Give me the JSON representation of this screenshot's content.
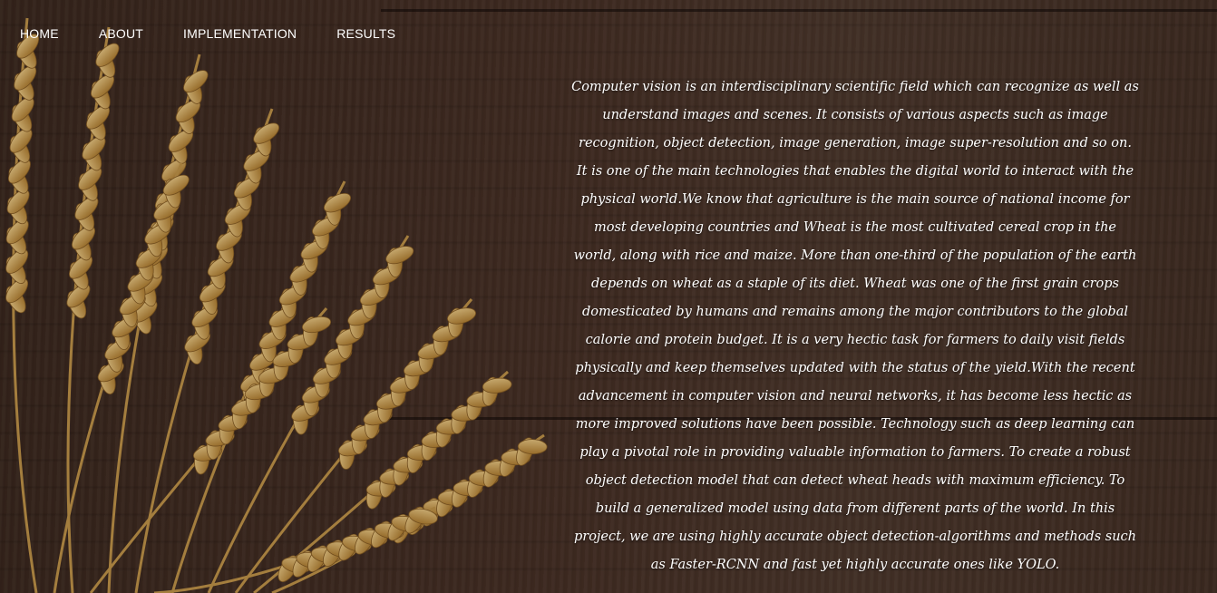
{
  "nav": {
    "items": [
      {
        "label": "HOME"
      },
      {
        "label": "ABOUT"
      },
      {
        "label": "IMPLEMENTATION"
      },
      {
        "label": "RESULTS"
      }
    ]
  },
  "main": {
    "intro_text": "Computer vision is an interdisciplinary scientific field which can recognize as well as understand images and scenes. It consists of various aspects such as image recognition, object detection, image generation, image super-resolution and so on. It is one of the main technologies that enables the digital world to interact with the physical world.We know that agriculture is the main source of national income for most developing countries and Wheat is the most cultivated cereal crop in the world, along with rice and maize. More than one-third of the population of the earth depends on wheat as a staple of its diet. Wheat was one of the first grain crops domesticated by humans and remains among the major contributors to the global calorie and protein budget. It is a very hectic task for farmers to daily visit fields physically and keep themselves updated with the status of the yield.With the recent advancement in computer vision and neural networks, it has become less hectic as more improved solutions have been possible. Technology such as deep learning can play a pivotal role in providing valuable information to farmers. To create a robust object detection model that can detect wheat heads with maximum efficiency. To build a generalized model using data from different parts of the world. In this project, we are using highly accurate object detection-algorithms and methods such as Faster-RCNN and fast yet highly accurate ones like YOLO."
  },
  "colors": {
    "wood": "#4a3227",
    "wheat": "#d9ab5a",
    "text": "#ffffff"
  }
}
